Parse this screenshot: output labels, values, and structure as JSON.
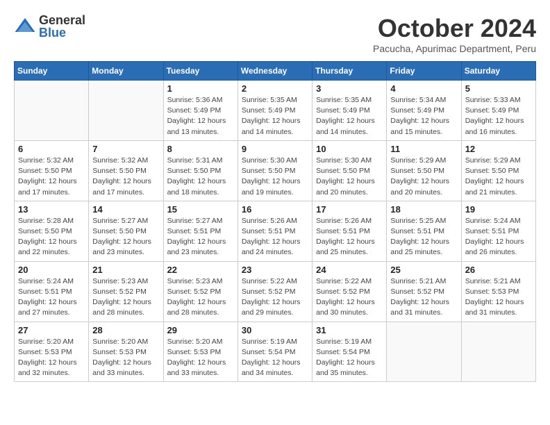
{
  "header": {
    "logo_general": "General",
    "logo_blue": "Blue",
    "month_title": "October 2024",
    "location": "Pacucha, Apurimac Department, Peru"
  },
  "days_of_week": [
    "Sunday",
    "Monday",
    "Tuesday",
    "Wednesday",
    "Thursday",
    "Friday",
    "Saturday"
  ],
  "weeks": [
    [
      {
        "day": "",
        "sunrise": "",
        "sunset": "",
        "daylight": "",
        "empty": true
      },
      {
        "day": "",
        "sunrise": "",
        "sunset": "",
        "daylight": "",
        "empty": true
      },
      {
        "day": "1",
        "sunrise": "Sunrise: 5:36 AM",
        "sunset": "Sunset: 5:49 PM",
        "daylight": "Daylight: 12 hours and 13 minutes."
      },
      {
        "day": "2",
        "sunrise": "Sunrise: 5:35 AM",
        "sunset": "Sunset: 5:49 PM",
        "daylight": "Daylight: 12 hours and 14 minutes."
      },
      {
        "day": "3",
        "sunrise": "Sunrise: 5:35 AM",
        "sunset": "Sunset: 5:49 PM",
        "daylight": "Daylight: 12 hours and 14 minutes."
      },
      {
        "day": "4",
        "sunrise": "Sunrise: 5:34 AM",
        "sunset": "Sunset: 5:49 PM",
        "daylight": "Daylight: 12 hours and 15 minutes."
      },
      {
        "day": "5",
        "sunrise": "Sunrise: 5:33 AM",
        "sunset": "Sunset: 5:49 PM",
        "daylight": "Daylight: 12 hours and 16 minutes."
      }
    ],
    [
      {
        "day": "6",
        "sunrise": "Sunrise: 5:32 AM",
        "sunset": "Sunset: 5:50 PM",
        "daylight": "Daylight: 12 hours and 17 minutes."
      },
      {
        "day": "7",
        "sunrise": "Sunrise: 5:32 AM",
        "sunset": "Sunset: 5:50 PM",
        "daylight": "Daylight: 12 hours and 17 minutes."
      },
      {
        "day": "8",
        "sunrise": "Sunrise: 5:31 AM",
        "sunset": "Sunset: 5:50 PM",
        "daylight": "Daylight: 12 hours and 18 minutes."
      },
      {
        "day": "9",
        "sunrise": "Sunrise: 5:30 AM",
        "sunset": "Sunset: 5:50 PM",
        "daylight": "Daylight: 12 hours and 19 minutes."
      },
      {
        "day": "10",
        "sunrise": "Sunrise: 5:30 AM",
        "sunset": "Sunset: 5:50 PM",
        "daylight": "Daylight: 12 hours and 20 minutes."
      },
      {
        "day": "11",
        "sunrise": "Sunrise: 5:29 AM",
        "sunset": "Sunset: 5:50 PM",
        "daylight": "Daylight: 12 hours and 20 minutes."
      },
      {
        "day": "12",
        "sunrise": "Sunrise: 5:29 AM",
        "sunset": "Sunset: 5:50 PM",
        "daylight": "Daylight: 12 hours and 21 minutes."
      }
    ],
    [
      {
        "day": "13",
        "sunrise": "Sunrise: 5:28 AM",
        "sunset": "Sunset: 5:50 PM",
        "daylight": "Daylight: 12 hours and 22 minutes."
      },
      {
        "day": "14",
        "sunrise": "Sunrise: 5:27 AM",
        "sunset": "Sunset: 5:50 PM",
        "daylight": "Daylight: 12 hours and 23 minutes."
      },
      {
        "day": "15",
        "sunrise": "Sunrise: 5:27 AM",
        "sunset": "Sunset: 5:51 PM",
        "daylight": "Daylight: 12 hours and 23 minutes."
      },
      {
        "day": "16",
        "sunrise": "Sunrise: 5:26 AM",
        "sunset": "Sunset: 5:51 PM",
        "daylight": "Daylight: 12 hours and 24 minutes."
      },
      {
        "day": "17",
        "sunrise": "Sunrise: 5:26 AM",
        "sunset": "Sunset: 5:51 PM",
        "daylight": "Daylight: 12 hours and 25 minutes."
      },
      {
        "day": "18",
        "sunrise": "Sunrise: 5:25 AM",
        "sunset": "Sunset: 5:51 PM",
        "daylight": "Daylight: 12 hours and 25 minutes."
      },
      {
        "day": "19",
        "sunrise": "Sunrise: 5:24 AM",
        "sunset": "Sunset: 5:51 PM",
        "daylight": "Daylight: 12 hours and 26 minutes."
      }
    ],
    [
      {
        "day": "20",
        "sunrise": "Sunrise: 5:24 AM",
        "sunset": "Sunset: 5:51 PM",
        "daylight": "Daylight: 12 hours and 27 minutes."
      },
      {
        "day": "21",
        "sunrise": "Sunrise: 5:23 AM",
        "sunset": "Sunset: 5:52 PM",
        "daylight": "Daylight: 12 hours and 28 minutes."
      },
      {
        "day": "22",
        "sunrise": "Sunrise: 5:23 AM",
        "sunset": "Sunset: 5:52 PM",
        "daylight": "Daylight: 12 hours and 28 minutes."
      },
      {
        "day": "23",
        "sunrise": "Sunrise: 5:22 AM",
        "sunset": "Sunset: 5:52 PM",
        "daylight": "Daylight: 12 hours and 29 minutes."
      },
      {
        "day": "24",
        "sunrise": "Sunrise: 5:22 AM",
        "sunset": "Sunset: 5:52 PM",
        "daylight": "Daylight: 12 hours and 30 minutes."
      },
      {
        "day": "25",
        "sunrise": "Sunrise: 5:21 AM",
        "sunset": "Sunset: 5:52 PM",
        "daylight": "Daylight: 12 hours and 31 minutes."
      },
      {
        "day": "26",
        "sunrise": "Sunrise: 5:21 AM",
        "sunset": "Sunset: 5:53 PM",
        "daylight": "Daylight: 12 hours and 31 minutes."
      }
    ],
    [
      {
        "day": "27",
        "sunrise": "Sunrise: 5:20 AM",
        "sunset": "Sunset: 5:53 PM",
        "daylight": "Daylight: 12 hours and 32 minutes."
      },
      {
        "day": "28",
        "sunrise": "Sunrise: 5:20 AM",
        "sunset": "Sunset: 5:53 PM",
        "daylight": "Daylight: 12 hours and 33 minutes."
      },
      {
        "day": "29",
        "sunrise": "Sunrise: 5:20 AM",
        "sunset": "Sunset: 5:53 PM",
        "daylight": "Daylight: 12 hours and 33 minutes."
      },
      {
        "day": "30",
        "sunrise": "Sunrise: 5:19 AM",
        "sunset": "Sunset: 5:54 PM",
        "daylight": "Daylight: 12 hours and 34 minutes."
      },
      {
        "day": "31",
        "sunrise": "Sunrise: 5:19 AM",
        "sunset": "Sunset: 5:54 PM",
        "daylight": "Daylight: 12 hours and 35 minutes."
      },
      {
        "day": "",
        "sunrise": "",
        "sunset": "",
        "daylight": "",
        "empty": true
      },
      {
        "day": "",
        "sunrise": "",
        "sunset": "",
        "daylight": "",
        "empty": true
      }
    ]
  ]
}
